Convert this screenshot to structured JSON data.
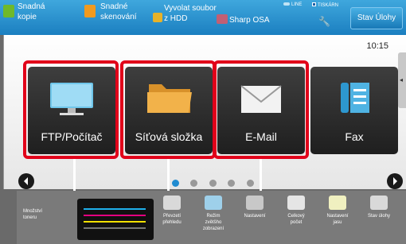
{
  "topbar": {
    "items": [
      {
        "label": "Snadná\nkopie",
        "icon": "copy-icon"
      },
      {
        "label": "Snadné\nskenování",
        "icon": "scan-icon"
      },
      {
        "label": "Vyvolat soubor\nz HDD",
        "icon": "folder-icon"
      },
      {
        "label": "Sharp OSA",
        "icon": "osa-icon"
      }
    ],
    "line_label": "LINE",
    "tisk_label": "TISKÁRN",
    "status_button": "Stav Úlohy"
  },
  "main": {
    "time": "10:15",
    "tiles": [
      {
        "label": "FTP/Počítač",
        "icon": "monitor-icon"
      },
      {
        "label": "Síťová složka",
        "icon": "folder-icon"
      },
      {
        "label": "E-Mail",
        "icon": "envelope-icon"
      },
      {
        "label": "Fax",
        "icon": "fax-icon"
      }
    ],
    "page_count": 5,
    "active_page": 1
  },
  "bottombar": {
    "toner_label": "Množství\ntoneru",
    "items": [
      {
        "label": "Převzetí\npřehledu",
        "icon": "document-icon"
      },
      {
        "label": "Režim\nzvětšho\nzobrazení",
        "icon": "zoom-text-icon"
      },
      {
        "label": "Nastavení",
        "icon": "wrench-icon"
      },
      {
        "label": "Celkový\npočet",
        "icon": "counter-icon"
      },
      {
        "label": "Nastavení\njasu",
        "icon": "brightness-icon"
      },
      {
        "label": "Stav úlohy",
        "icon": "job-status-icon"
      }
    ]
  },
  "colors": {
    "accent_blue": "#1b7fc0",
    "highlight_red": "#e1001a"
  }
}
